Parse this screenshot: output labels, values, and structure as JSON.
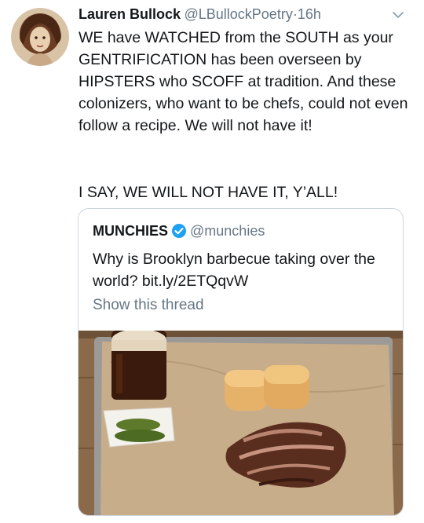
{
  "tweet": {
    "author_name": "Lauren Bullock",
    "author_handle": "@LBullockPoetry",
    "separator": "·",
    "time": "16h",
    "body_line1": "WE have WATCHED from the SOUTH as your GENTRIFICATION has been overseen by HIPSTERS who SCOFF at tradition. And these colonizers, who want to be chefs, could not even follow a recipe. We will not have it!",
    "body_line2": "I SAY, WE WILL NOT HAVE IT, Y’ALL!"
  },
  "quoted": {
    "author_name": "MUNCHIES",
    "author_handle": "@munchies",
    "text": "Why is Brooklyn barbecue taking over the world? bit.ly/2ETQqvW",
    "show_thread": "Show this thread"
  },
  "icons": {
    "menu": "chevron-down-icon",
    "verified": "verified-badge-icon"
  },
  "colors": {
    "text": "#14171a",
    "secondary": "#657786",
    "verified": "#1da1f2",
    "border": "#ccd6dd"
  }
}
